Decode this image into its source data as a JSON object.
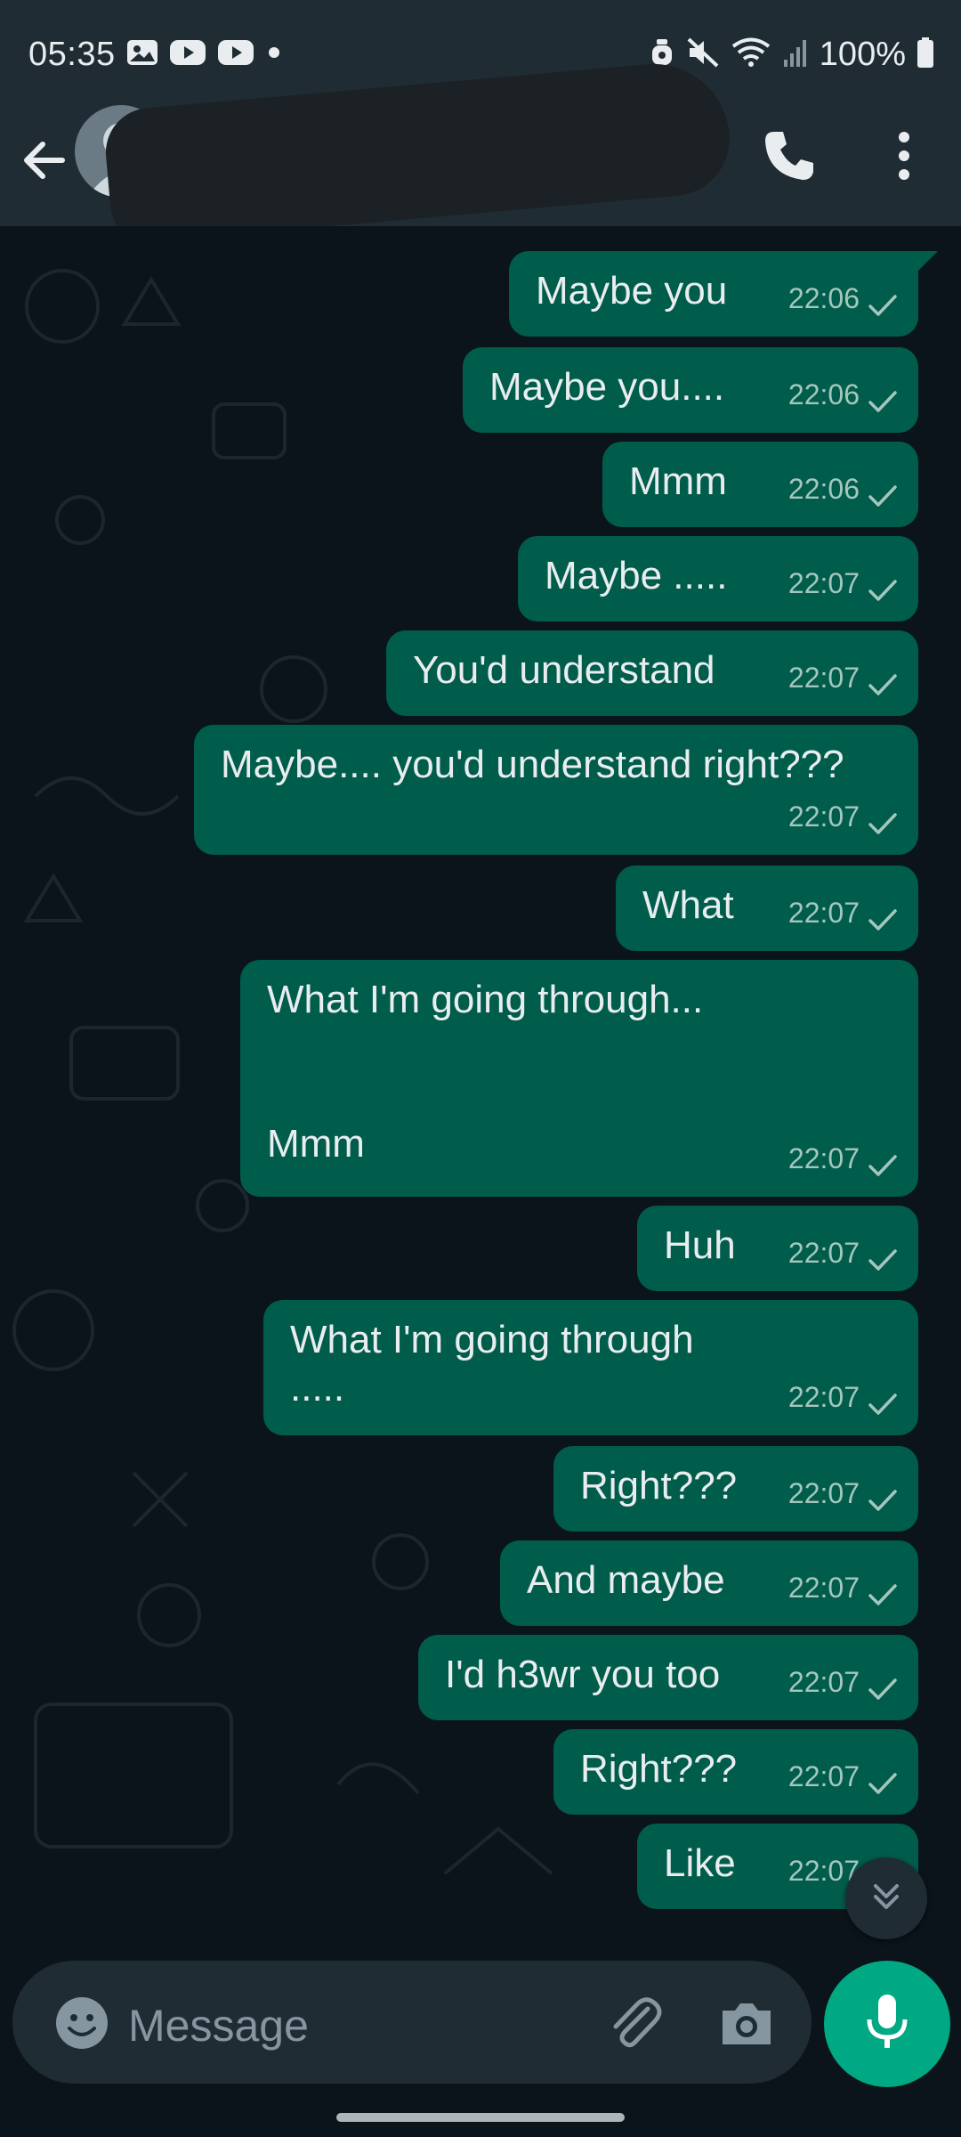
{
  "status_bar": {
    "time": "05:35",
    "battery_percent": "100%",
    "icons": [
      "gallery-icon",
      "youtube-icon",
      "youtube-icon",
      "dot-icon",
      "alarm-icon",
      "mute-icon",
      "wifi-icon",
      "signal-icon",
      "battery-icon"
    ]
  },
  "header": {
    "contact_name": "",
    "icons": [
      "back-arrow-icon",
      "avatar-icon",
      "voice-call-icon",
      "more-vert-icon"
    ]
  },
  "messages": [
    {
      "text": "Maybe you",
      "time": "22:06",
      "status": "sent"
    },
    {
      "text": "Maybe you....",
      "time": "22:06",
      "status": "sent"
    },
    {
      "text": "Mmm",
      "time": "22:06",
      "status": "sent"
    },
    {
      "text": "Maybe .....",
      "time": "22:07",
      "status": "sent"
    },
    {
      "text": "You'd understand",
      "time": "22:07",
      "status": "sent"
    },
    {
      "text": "Maybe.... you'd understand right???",
      "time": "22:07",
      "status": "sent"
    },
    {
      "text": "What",
      "time": "22:07",
      "status": "sent"
    },
    {
      "text": "What I'm going through...\n\n\nMmm",
      "time": "22:07",
      "status": "sent"
    },
    {
      "text": "Huh",
      "time": "22:07",
      "status": "sent"
    },
    {
      "text": "What I'm going through\n.....",
      "time": "22:07",
      "status": "sent"
    },
    {
      "text": "Right???",
      "time": "22:07",
      "status": "sent"
    },
    {
      "text": "And maybe",
      "time": "22:07",
      "status": "sent"
    },
    {
      "text": "I'd h3wr you too",
      "time": "22:07",
      "status": "sent"
    },
    {
      "text": "Right???",
      "time": "22:07",
      "status": "sent"
    },
    {
      "text": "Like",
      "time": "22:07",
      "status": "sent"
    }
  ],
  "composer": {
    "placeholder": "Message",
    "icons": [
      "emoji-icon",
      "attach-icon",
      "camera-icon",
      "mic-icon"
    ]
  },
  "colors": {
    "background": "#0b141a",
    "bar": "#1f2c34",
    "outgoing_bubble": "#005c4b",
    "accent": "#00a884",
    "meta_text": "#a5c6bd"
  }
}
